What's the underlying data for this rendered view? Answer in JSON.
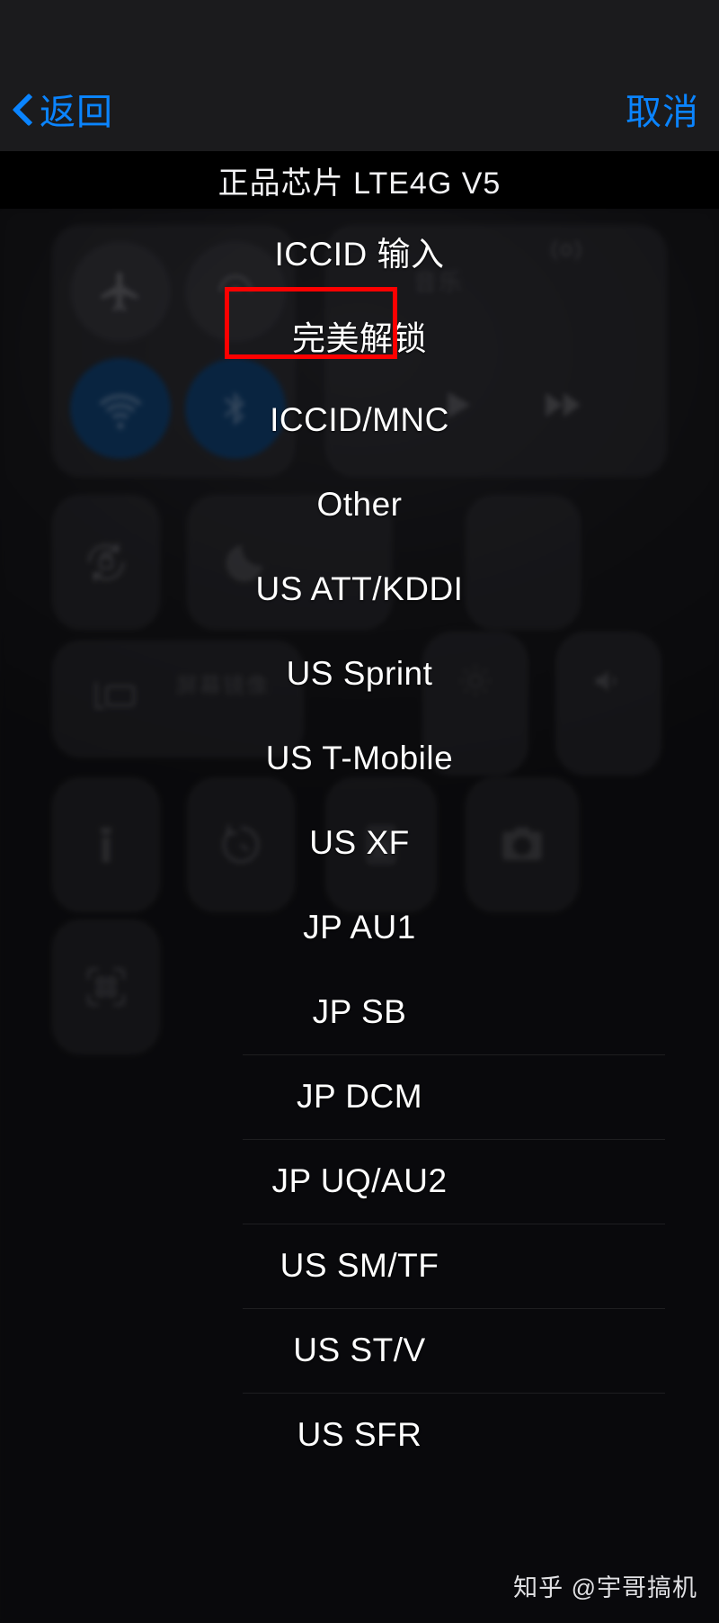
{
  "nav": {
    "back_label": "返回",
    "back_icon": "chevron-left-icon",
    "cancel_label": "取消",
    "accent_color": "#0a84ff"
  },
  "titlebar": {
    "title": "正品芯片 LTE4G V5",
    "background_color": "#000000",
    "text_color": "#f2f2f4"
  },
  "option_list": {
    "highlight_color": "#fe0000",
    "highlighted_item": "完美解锁",
    "items": [
      {
        "label": "ICCID 输入",
        "divider": false
      },
      {
        "label": "完美解锁",
        "divider": false
      },
      {
        "label": "ICCID/MNC",
        "divider": false
      },
      {
        "label": "Other",
        "divider": false
      },
      {
        "label": "US ATT/KDDI",
        "divider": false
      },
      {
        "label": "US Sprint",
        "divider": false
      },
      {
        "label": "US T-Mobile",
        "divider": false
      },
      {
        "label": "US XF",
        "divider": false
      },
      {
        "label": "JP AU1",
        "divider": false
      },
      {
        "label": "JP SB",
        "divider": false
      },
      {
        "label": "JP DCM",
        "divider": true
      },
      {
        "label": "JP UQ/AU2",
        "divider": true
      },
      {
        "label": "US SM/TF",
        "divider": true
      },
      {
        "label": "US ST/V",
        "divider": true
      },
      {
        "label": "US SFR",
        "divider": true
      }
    ]
  },
  "backdrop": {
    "description": "blurred iOS control center",
    "music_label": "音乐",
    "screen_mirroring_label": "屏幕镜像",
    "icons": [
      "airplane-mode-icon",
      "cellular-data-icon",
      "wifi-icon",
      "bluetooth-icon",
      "music-note-icon",
      "play-icon",
      "forward-icon",
      "rotation-lock-icon",
      "do-not-disturb-icon",
      "screen-mirroring-icon",
      "brightness-slider",
      "volume-slider",
      "flashlight-icon",
      "timer-icon",
      "calculator-icon",
      "camera-icon",
      "qr-scanner-icon"
    ]
  },
  "watermark": {
    "text": "知乎 @宇哥搞机"
  }
}
